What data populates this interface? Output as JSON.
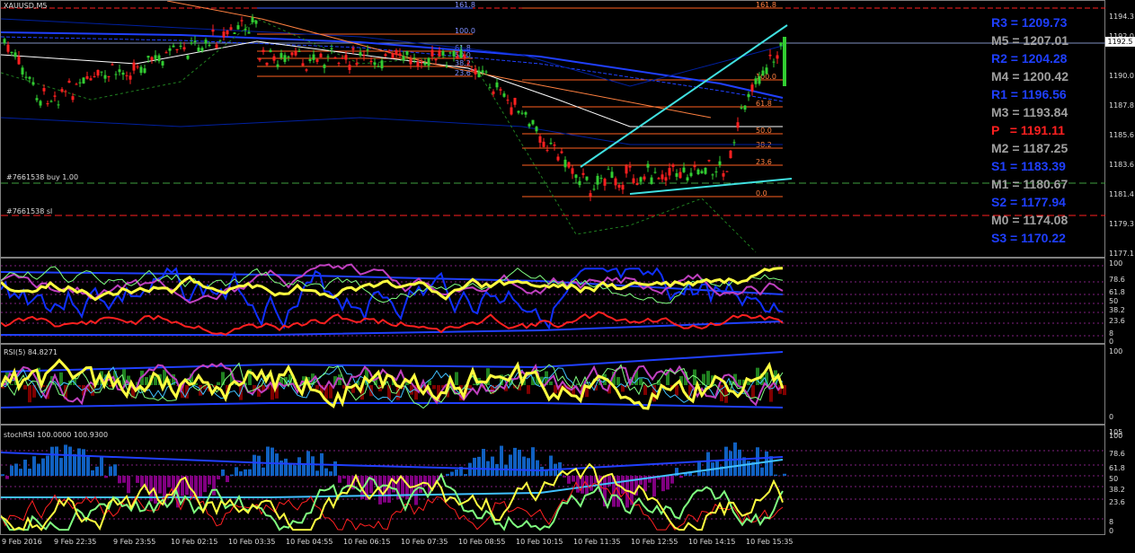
{
  "window": {
    "symbol_label": "XAUUSD,M5"
  },
  "price_scale": {
    "ticks": [
      "1194.3",
      "1192.0",
      "1190.0",
      "1187.8",
      "1185.6",
      "1183.6",
      "1181.4",
      "1179.3",
      "1177.1"
    ],
    "current_price": "1192.5"
  },
  "pivots": [
    {
      "label": "R3 = 1209.73",
      "color": "#1f3fff"
    },
    {
      "label": "M5 = 1207.01",
      "color": "#a0a0a0"
    },
    {
      "label": "R2 = 1204.28",
      "color": "#1f3fff"
    },
    {
      "label": "M4 = 1200.42",
      "color": "#a0a0a0"
    },
    {
      "label": "R1 = 1196.56",
      "color": "#1f3fff"
    },
    {
      "label": "M3 = 1193.84",
      "color": "#a0a0a0"
    },
    {
      "label": "P   = 1191.11",
      "color": "#ff2020"
    },
    {
      "label": "M2 = 1187.25",
      "color": "#a0a0a0"
    },
    {
      "label": "S1 = 1183.39",
      "color": "#1f3fff"
    },
    {
      "label": "M1 = 1180.67",
      "color": "#a0a0a0"
    },
    {
      "label": "S2 = 1177.94",
      "color": "#1f3fff"
    },
    {
      "label": "M0 = 1174.08",
      "color": "#a0a0a0"
    },
    {
      "label": "S3 = 1170.22",
      "color": "#1f3fff"
    }
  ],
  "fib_left": [
    "161.8",
    "100.0",
    "61.8",
    "50.0",
    "38.2",
    "23.6"
  ],
  "fib_right": [
    "161.8",
    "100.0",
    "61.8",
    "50.0",
    "38.2",
    "23.6",
    "0.0"
  ],
  "orders": {
    "buy": "#7661538 buy 1.00",
    "sl": "#7661538 sl"
  },
  "indicator1": {
    "ticks": [
      "100",
      "78.6",
      "61.8",
      "50",
      "38.2",
      "23.6",
      "8",
      "0"
    ]
  },
  "indicator2": {
    "title": "RSI(5) 84.8271",
    "ticks": [
      "100",
      "0"
    ]
  },
  "indicator3": {
    "title": "stochRSI 100.0000 100.9300",
    "ticks": [
      "105",
      "100",
      "78.6",
      "61.8",
      "50",
      "38.2",
      "23.6",
      "8",
      "0"
    ]
  },
  "time_axis": [
    "9 Feb 2016",
    "9 Feb 22:35",
    "9 Feb 23:55",
    "10 Feb 02:15",
    "10 Feb 03:35",
    "10 Feb 04:55",
    "10 Feb 06:15",
    "10 Feb 07:35",
    "10 Feb 08:55",
    "10 Feb 10:15",
    "10 Feb 11:35",
    "10 Feb 12:55",
    "10 Feb 14:15",
    "10 Feb 15:35"
  ],
  "colors": {
    "bull": "#32cd32",
    "bear": "#ff2020",
    "pivot_blue": "#1f3fff",
    "pivot_grey": "#a0a0a0",
    "pivot_red": "#ff2020"
  }
}
